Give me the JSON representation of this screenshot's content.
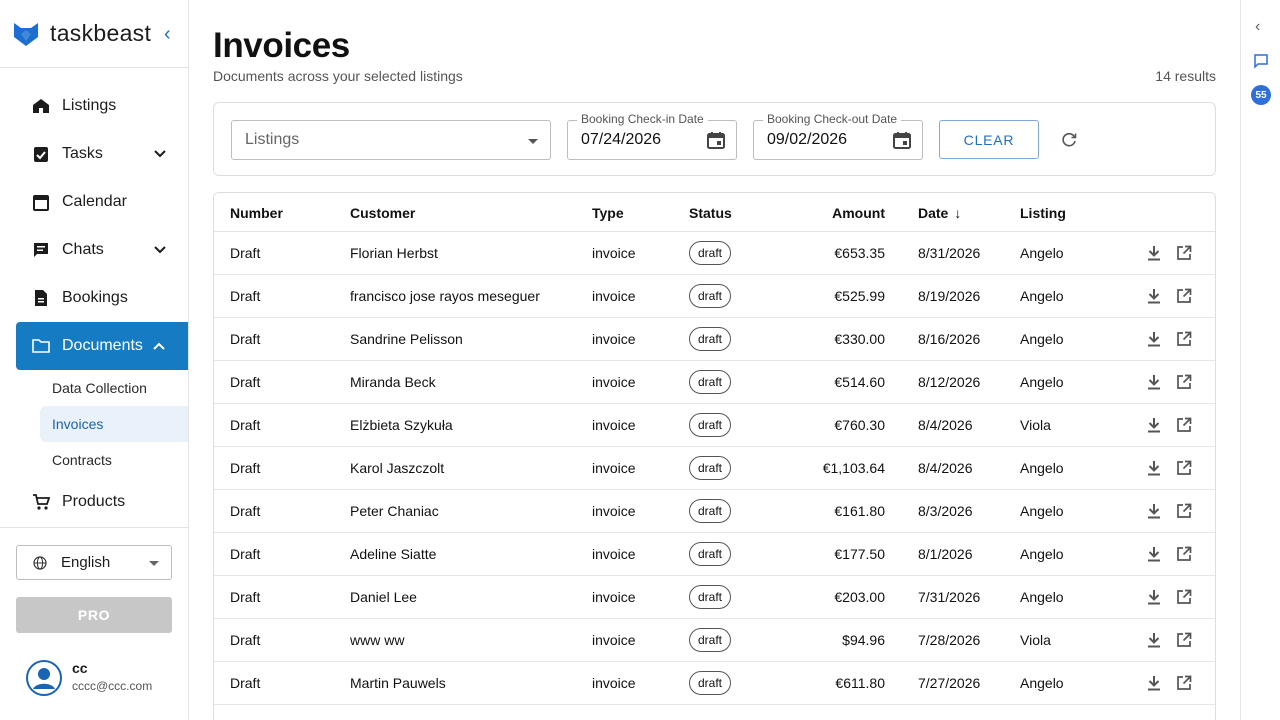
{
  "brand": {
    "name": "taskbeast"
  },
  "nav": {
    "items": [
      {
        "label": "Listings"
      },
      {
        "label": "Tasks"
      },
      {
        "label": "Calendar"
      },
      {
        "label": "Chats"
      },
      {
        "label": "Bookings"
      },
      {
        "label": "Documents"
      }
    ],
    "documents_sub": [
      {
        "label": "Data Collection"
      },
      {
        "label": "Invoices"
      },
      {
        "label": "Contracts"
      }
    ],
    "products": {
      "label": "Products"
    }
  },
  "language": {
    "value": "English"
  },
  "pro": {
    "label": "PRO"
  },
  "user": {
    "name": "cc",
    "email": "cccc@ccc.com"
  },
  "rail": {
    "badge": "55"
  },
  "page": {
    "title": "Invoices",
    "subtitle": "Documents across your selected listings",
    "results": "14 results"
  },
  "filters": {
    "listings_placeholder": "Listings",
    "checkin_label": "Booking Check-in Date",
    "checkin_value": "07/24/2026",
    "checkout_label": "Booking Check-out Date",
    "checkout_value": "09/02/2026",
    "clear_label": "CLEAR"
  },
  "table": {
    "headers": {
      "number": "Number",
      "customer": "Customer",
      "type": "Type",
      "status": "Status",
      "amount": "Amount",
      "date": "Date",
      "listing": "Listing"
    },
    "rows": [
      {
        "number": "Draft",
        "customer": "Florian Herbst",
        "type": "invoice",
        "status": "draft",
        "amount": "€653.35",
        "date": "8/31/2026",
        "listing": "Angelo"
      },
      {
        "number": "Draft",
        "customer": "francisco jose rayos meseguer",
        "type": "invoice",
        "status": "draft",
        "amount": "€525.99",
        "date": "8/19/2026",
        "listing": "Angelo"
      },
      {
        "number": "Draft",
        "customer": "Sandrine Pelisson",
        "type": "invoice",
        "status": "draft",
        "amount": "€330.00",
        "date": "8/16/2026",
        "listing": "Angelo"
      },
      {
        "number": "Draft",
        "customer": "Miranda Beck",
        "type": "invoice",
        "status": "draft",
        "amount": "€514.60",
        "date": "8/12/2026",
        "listing": "Angelo"
      },
      {
        "number": "Draft",
        "customer": "Elżbieta Szykuła",
        "type": "invoice",
        "status": "draft",
        "amount": "€760.30",
        "date": "8/4/2026",
        "listing": "Viola"
      },
      {
        "number": "Draft",
        "customer": "Karol Jaszczolt",
        "type": "invoice",
        "status": "draft",
        "amount": "€1,103.64",
        "date": "8/4/2026",
        "listing": "Angelo"
      },
      {
        "number": "Draft",
        "customer": "Peter Chaniac",
        "type": "invoice",
        "status": "draft",
        "amount": "€161.80",
        "date": "8/3/2026",
        "listing": "Angelo"
      },
      {
        "number": "Draft",
        "customer": "Adeline Siatte",
        "type": "invoice",
        "status": "draft",
        "amount": "€177.50",
        "date": "8/1/2026",
        "listing": "Angelo"
      },
      {
        "number": "Draft",
        "customer": "Daniel Lee",
        "type": "invoice",
        "status": "draft",
        "amount": "€203.00",
        "date": "7/31/2026",
        "listing": "Angelo"
      },
      {
        "number": "Draft",
        "customer": "www ww",
        "type": "invoice",
        "status": "draft",
        "amount": "$94.96",
        "date": "7/28/2026",
        "listing": "Viola"
      },
      {
        "number": "Draft",
        "customer": "Martin Pauwels",
        "type": "invoice",
        "status": "draft",
        "amount": "€611.80",
        "date": "7/27/2026",
        "listing": "Angelo"
      }
    ]
  }
}
